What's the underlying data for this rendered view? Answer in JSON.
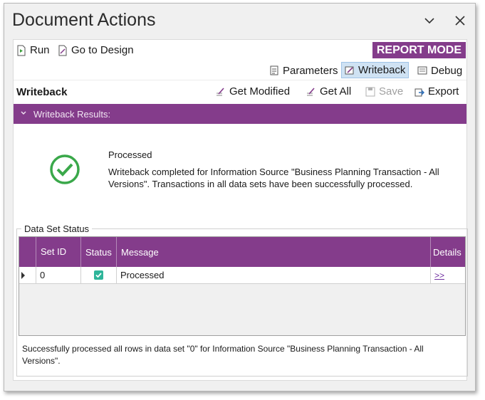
{
  "window": {
    "title": "Document Actions"
  },
  "toolbar": {
    "run_label": "Run",
    "go_to_design_label": "Go to Design",
    "report_mode_label": "REPORT MODE"
  },
  "tabs": {
    "parameters_label": "Parameters",
    "writeback_label": "Writeback",
    "debug_label": "Debug",
    "active": "Writeback"
  },
  "writeback_toolbar": {
    "title": "Writeback",
    "get_modified_label": "Get Modified",
    "get_all_label": "Get All",
    "save_label": "Save",
    "export_label": "Export"
  },
  "results_section": {
    "header": "Writeback Results:",
    "status_title": "Processed",
    "message": "Writeback completed for Information Source \"Business Planning Transaction - All Versions\". Transactions in all data sets have been successfully processed."
  },
  "data_set_status": {
    "legend": "Data Set Status",
    "columns": {
      "set_id": "Set ID",
      "status": "Status",
      "message": "Message",
      "details": "Details"
    },
    "rows": [
      {
        "set_id": "0",
        "status_checked": true,
        "message": "Processed",
        "details": ">>"
      }
    ],
    "footer_message": "Successfully processed all rows in data set \"0\" for Information Source \"Business Planning Transaction - All Versions\"."
  },
  "colors": {
    "accent_purple": "#843c8b",
    "success_green": "#2fb59a",
    "active_tab_bg": "#cfe2f3"
  },
  "icons": [
    "run-icon",
    "design-icon",
    "parameters-icon",
    "writeback-icon",
    "debug-icon",
    "get-modified-icon",
    "get-all-icon",
    "save-icon",
    "export-icon",
    "chevron-down-icon",
    "close-icon",
    "success-check-icon"
  ]
}
